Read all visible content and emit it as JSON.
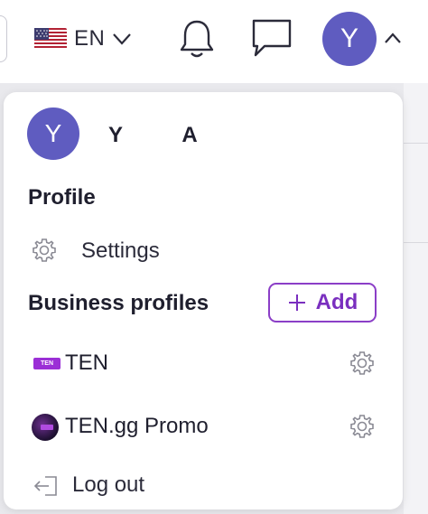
{
  "topbar": {
    "language": {
      "code": "EN",
      "flag_icon": "us-flag-icon"
    },
    "notifications_icon": "bell-icon",
    "messages_icon": "chat-bubble-icon",
    "avatar_initial": "Y",
    "menu_toggle_icon": "chevron-up-icon"
  },
  "menu": {
    "user": {
      "avatar_initial": "Y",
      "name": "Y          A"
    },
    "profile_section": {
      "title": "Profile"
    },
    "settings": {
      "label": "Settings",
      "icon": "gear-icon"
    },
    "business_section": {
      "title": "Business profiles",
      "add_label": "Add"
    },
    "business_profiles": [
      {
        "logo_text": "TEN",
        "name": "TEN"
      },
      {
        "name": "TEN.gg Promo"
      }
    ],
    "logout": {
      "label": "Log out",
      "icon": "logout-icon"
    }
  },
  "colors": {
    "avatar": "#5f5cc0",
    "accent_purple": "#8b3ec7",
    "text_dark": "#1f1f2e"
  }
}
